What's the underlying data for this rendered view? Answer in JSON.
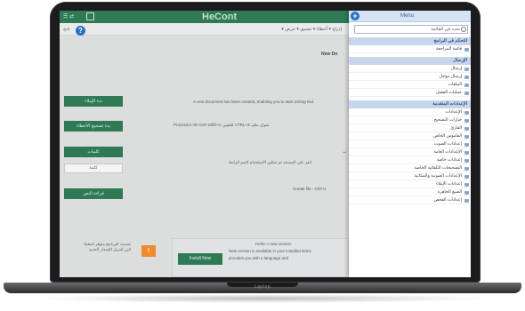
{
  "device": {
    "label": "Laptop"
  },
  "app": {
    "title": "HeCont",
    "top_left": "☰ ⇄",
    "colors": {
      "accent": "#2f7a55",
      "menu_header": "#c7d6ea",
      "help": "#2b6fc4",
      "orange": "#ef8b2c"
    }
  },
  "toolbar": {
    "left": "فتح",
    "tools": "إدراج ▾   أخطاء ▾   تنسيق ▾   عرض ▾"
  },
  "main": {
    "doc_title": "New Do",
    "buttons": [
      "بدء الإملاء",
      "بدء تصحيح الأخطاء",
      "كلمات",
      "قراءة النص"
    ],
    "field": "كلمة",
    "lines": [
      "A new document has been created, enabling you to start writing text.",
      "Processor Alt+Ctrl+Shift+U للتعيين CTRL+Z عنوان ملف",
      "ب",
      "انقر على المستند ثم تمكين الاستخدام لاسم الرابط",
      "Create file - Ctrl+U"
    ],
    "notice": "تحديث البرنامج متوفر اضغط الزر لتنزيل الإصدار الجديد",
    "orange_badge": "!",
    "install_button": "Install Now",
    "footer_lines": [
      "Hello! A new version",
      "New version is available in your installed items",
      "provides you with a language and"
    ]
  },
  "menu": {
    "title": "Menu",
    "search_placeholder": "بحث في القائمة",
    "sections": [
      {
        "header": "التحكم في البرامج",
        "items": [
          "قائمة المراجعة"
        ]
      },
      {
        "header": "الإرسال",
        "items": [
          "إرسال",
          "إرسال مؤجل",
          "الملفات",
          "عمليات الفصل"
        ]
      },
      {
        "header": "الإعدادات المتقدمة",
        "items": [
          "الإعدادات",
          "خيارات التصحيح",
          "القارئ",
          "القاموس الخاص",
          "إعدادات الصوت",
          "الإعدادات العامة",
          "إعدادات خاصة",
          "التصحيحات التلقائية الخاصة",
          "الإعدادات الصوتية والمكانية",
          "إعدادات الإملاء",
          "الصيغ الجاهزة",
          "إعدادات الفحص"
        ]
      }
    ]
  }
}
